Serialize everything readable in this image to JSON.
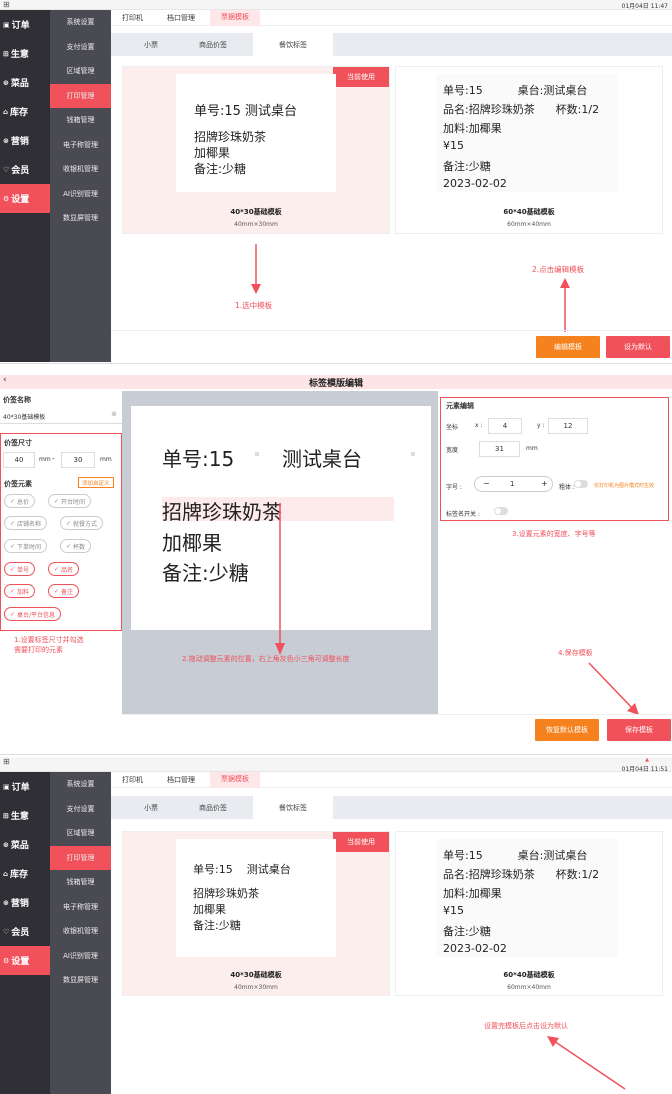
{
  "panel1": {
    "topbar": {
      "grid_icon": "⊞",
      "time": "01月04日 11:47"
    },
    "nav1": [
      {
        "icon": "▣",
        "label": "订单"
      },
      {
        "icon": "⊞",
        "label": "生意"
      },
      {
        "icon": "⊛",
        "label": "菜品"
      },
      {
        "icon": "⌂",
        "label": "库存"
      },
      {
        "icon": "⊗",
        "label": "营销"
      },
      {
        "icon": "♡",
        "label": "会员"
      },
      {
        "icon": "⚙",
        "label": "设置"
      }
    ],
    "nav2": [
      "系统设置",
      "支付设置",
      "区域管理",
      "打印管理",
      "钱箱管理",
      "电子称管理",
      "收银机管理",
      "AI识别管理",
      "数显屏管理"
    ],
    "tabs1": [
      "打印机",
      "档口管理",
      "票据模板"
    ],
    "tabs2": [
      "小票",
      "商品价签",
      "餐饮标签"
    ],
    "card1": {
      "badge": "当前使用",
      "lines": [
        "单号:15    测试桌台",
        "招牌珍珠奶茶",
        "加椰果",
        "备注:少糖"
      ],
      "name": "40*30基础模板",
      "size": "40mm×30mm"
    },
    "card2": {
      "lines": [
        "单号:15          桌台:测试桌台",
        "品名:招牌珍珠奶茶      杯数:1/2",
        "加料:加椰果",
        "¥15",
        "备注:少糖",
        "2023-02-02"
      ],
      "name": "60*40基础模板",
      "size": "60mm×40mm"
    },
    "annot_1": "1.选中模板",
    "annot_2": "2.点击编辑模板",
    "btn_edit": "编辑模板",
    "btn_default": "设为默认"
  },
  "panel2": {
    "header": {
      "back": "‹",
      "title": "标签模版编辑"
    },
    "label_name_title": "价签名称",
    "label_name_value": "40*30基础模板",
    "size_title": "价签尺寸",
    "width_value": "40",
    "height_value": "30",
    "unit": "mm",
    "dash": "-",
    "elements_title": "价签元素",
    "add_custom": "添加自定义",
    "chips_off": [
      "总价",
      "开台时间",
      "店铺名称",
      "就餐方式",
      "下单时间",
      "杯数"
    ],
    "chips_on": [
      "单号",
      "品名",
      "加料",
      "备注",
      "桌台/平台信息"
    ],
    "left_note": [
      "1.设置标签尺寸并勾选",
      "需要打印的元素"
    ],
    "canvas_lines": [
      "单号:15",
      "测试桌台",
      "招牌珍珠奶茶",
      "加椰果",
      "备注:少糖"
    ],
    "canvas_note": "2.拖动调整元素的位置，右上角灰色小三角可调整长度",
    "editor": {
      "title": "元素编辑",
      "coord_label": "坐标",
      "x_label": "x :",
      "x_value": "4",
      "y_label": "y :",
      "y_value": "12",
      "width_label": "宽度",
      "width_value": "31",
      "width_unit": "mm",
      "font_label": "字号 :",
      "minus": "−",
      "font_value": "1",
      "plus": "+",
      "bold_label": "粗体 :",
      "bold_hint": "仅打印机为图片模式时生效",
      "switch_label": "标签名开关 :"
    },
    "right_note_3": "3.设置元素的宽度、字号等",
    "right_note_4": "4.保存模板",
    "btn_restore": "恢复默认模板",
    "btn_save": "保存模板"
  },
  "panel3": {
    "topbar": {
      "grid_icon": "⊞",
      "time": "01月04日 11:51",
      "user_icon": "▲"
    },
    "annot": "设置完模板后点击设为默认"
  },
  "colors": {
    "accent": "#f0515b",
    "orange": "#f5821f",
    "nav_dark": "#2f2f35",
    "nav_mid": "#4a4a52"
  }
}
